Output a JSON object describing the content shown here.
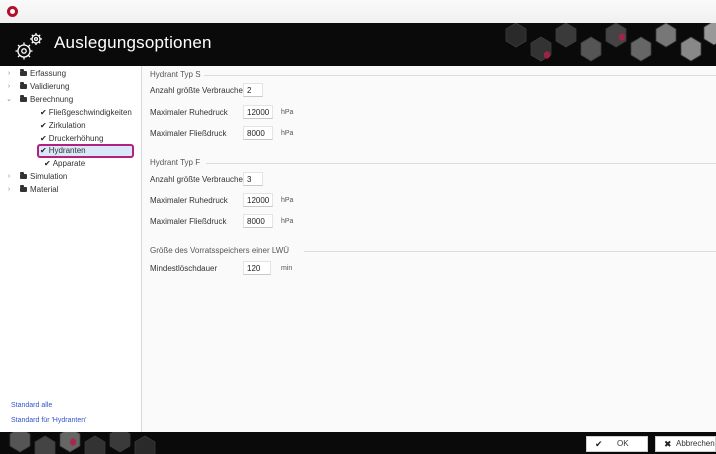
{
  "header": {
    "title": "Auslegungsoptionen"
  },
  "tree": {
    "items": [
      {
        "label": "Erfassung",
        "expander": "›",
        "kind": "folder"
      },
      {
        "label": "Validierung",
        "expander": "›",
        "kind": "folder"
      },
      {
        "label": "Berechnung",
        "expander": "⌄",
        "kind": "folder"
      },
      {
        "label": "Fließgeschwindigkeiten",
        "kind": "check"
      },
      {
        "label": "Zirkulation",
        "kind": "check"
      },
      {
        "label": "Druckerhöhung",
        "kind": "check"
      },
      {
        "label": "Hydranten",
        "kind": "check",
        "selected": true
      },
      {
        "label": "Apparate",
        "kind": "check"
      },
      {
        "label": "Simulation",
        "expander": "›",
        "kind": "folder"
      },
      {
        "label": "Material",
        "expander": "›",
        "kind": "folder"
      }
    ],
    "link_standard_all": "Standard alle",
    "link_standard_current": "Standard für 'Hydranten'"
  },
  "sections": {
    "typ_s": {
      "title": "Hydrant Typ S",
      "count_label": "Anzahl größte Verbraucher",
      "count_value": "2",
      "rest_label": "Maximaler Ruhedruck",
      "rest_value": "12000",
      "rest_unit": "hPa",
      "flow_label": "Maximaler Fließdruck",
      "flow_value": "8000",
      "flow_unit": "hPa"
    },
    "typ_f": {
      "title": "Hydrant Typ F",
      "count_label": "Anzahl größte Verbraucher",
      "count_value": "3",
      "rest_label": "Maximaler Ruhedruck",
      "rest_value": "12000",
      "rest_unit": "hPa",
      "flow_label": "Maximaler Fließdruck",
      "flow_value": "8000",
      "flow_unit": "hPa"
    },
    "storage": {
      "title": "Größe des Vorratsspeichers einer LWÜ",
      "dur_label": "Mindestlöschdauer",
      "dur_value": "120",
      "dur_unit": "min"
    }
  },
  "footer": {
    "ok_label": "OK",
    "cancel_label": "Abbrechen"
  },
  "colors": {
    "header_bg": "#0a0a0a",
    "selection_border": "#b3207e",
    "selection_fill": "#d8e8f8",
    "link": "#3355cc"
  },
  "icons": {
    "app": "app-logo-icon",
    "header": "gears-icon",
    "folder": "folder-icon",
    "check": "checkmark-icon",
    "ok": "checkmark-icon",
    "cancel": "x-icon"
  }
}
